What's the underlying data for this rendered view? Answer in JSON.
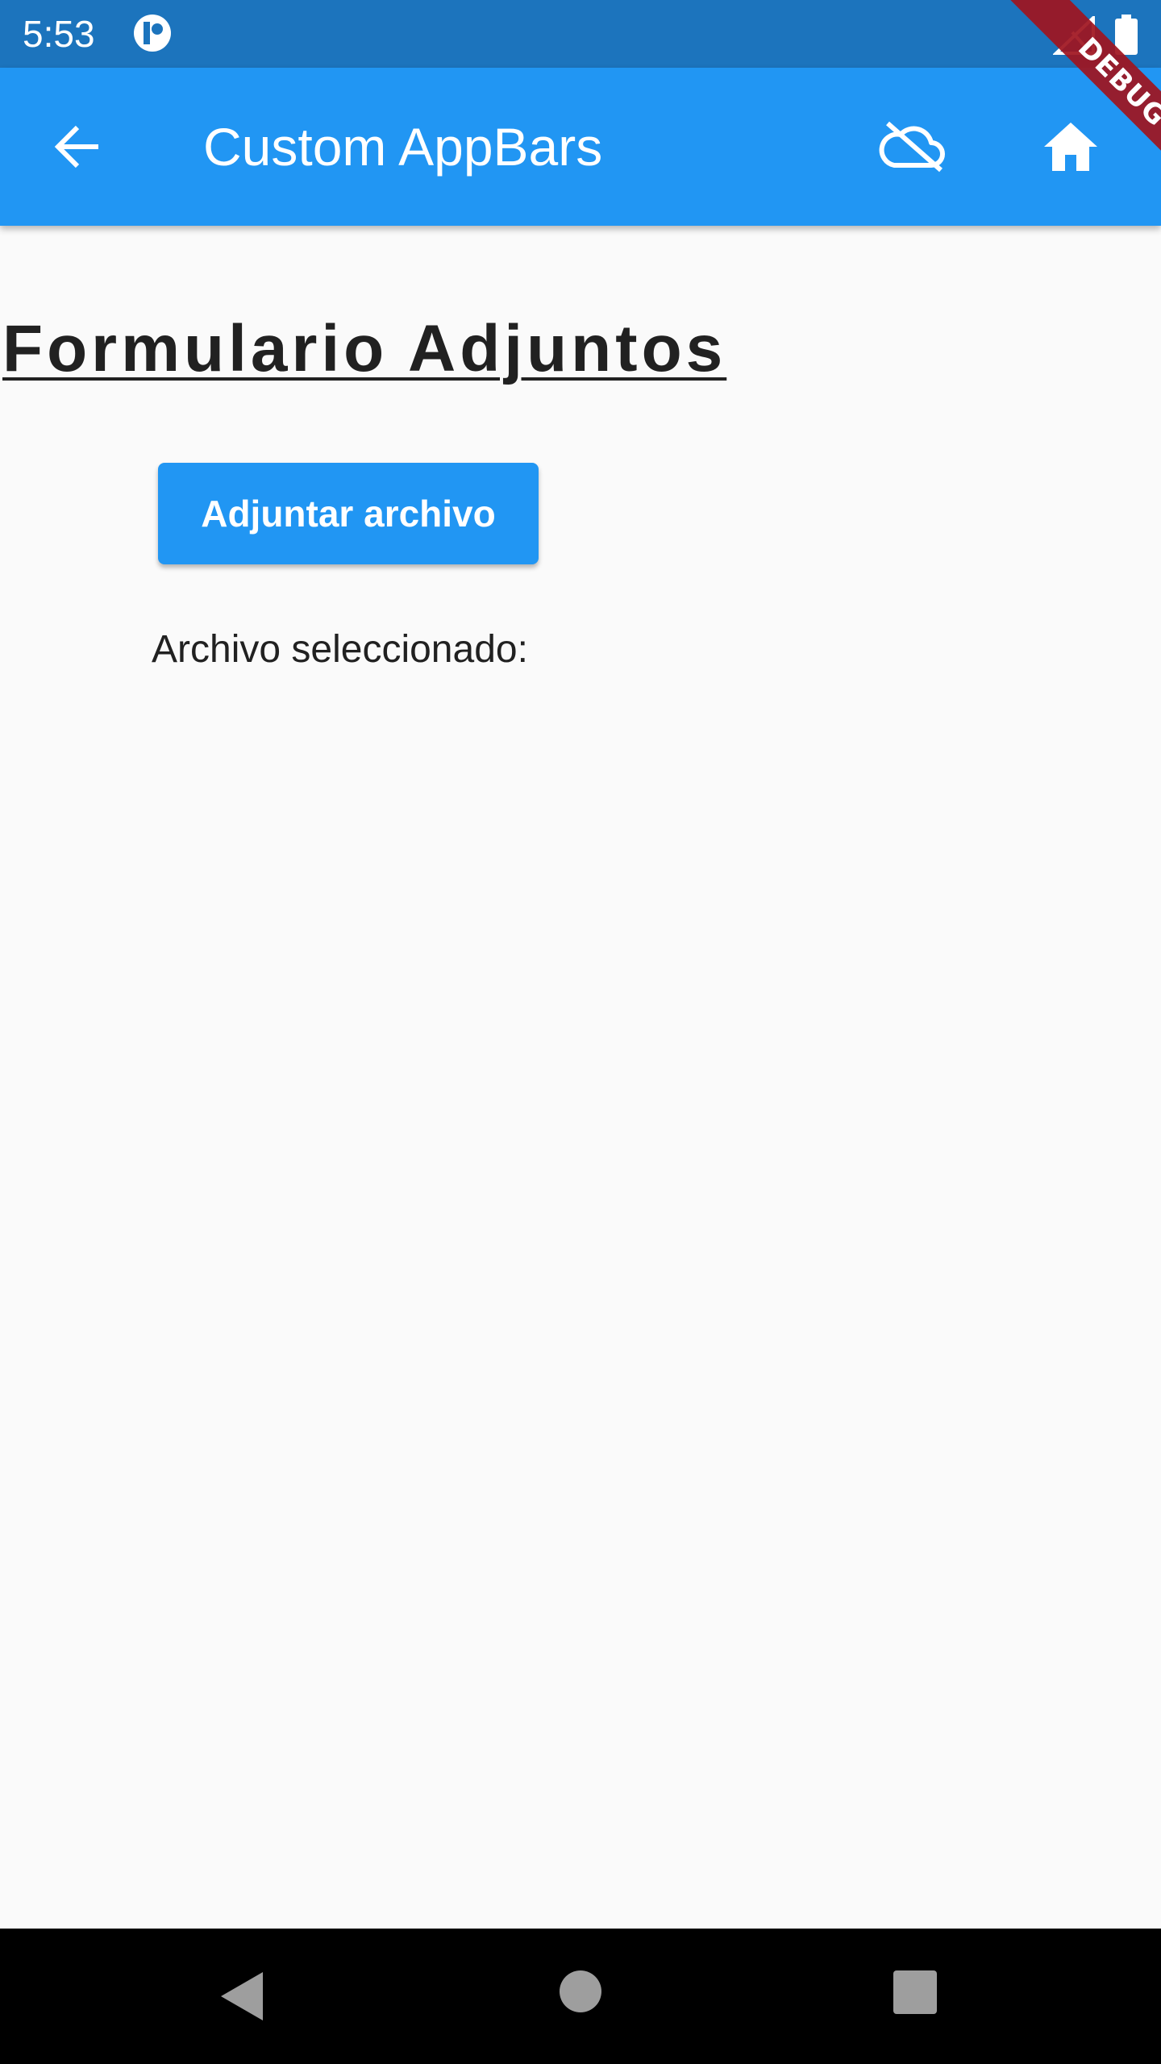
{
  "status_bar": {
    "time": "5:53",
    "icons": [
      "app-notification-icon",
      "signal-icon",
      "battery-icon"
    ]
  },
  "app_bar": {
    "title": "Custom AppBars",
    "background_color": "#2196f3",
    "actions": [
      "back-arrow-icon",
      "cloud-off-icon",
      "home-icon"
    ]
  },
  "debug_banner": {
    "label": "DEBUG"
  },
  "form": {
    "title": "Formulario Adjuntos",
    "attach_button_label": "Adjuntar archivo",
    "selected_file_label": "Archivo seleccionado:"
  },
  "nav_bar": {
    "icons": [
      "nav-back-icon",
      "nav-home-icon",
      "nav-recents-icon"
    ]
  }
}
